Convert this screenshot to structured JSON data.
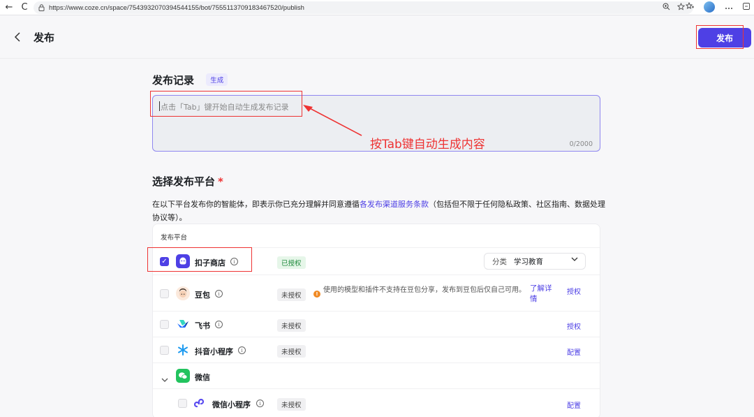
{
  "browser": {
    "url": "https://www.coze.cn/space/7543932070394544155/bot/7555113709183467520/publish",
    "nav": {
      "back": "←",
      "reload": "C"
    }
  },
  "header": {
    "back_icon": "‹",
    "title": "发布",
    "publish_label": "发布"
  },
  "record": {
    "title": "发布记录",
    "generate_tag": "生成",
    "placeholder": "点击「Tab」键开始自动生成发布记录",
    "count": "0/2000"
  },
  "annotation": {
    "text": "按Tab键自动生成内容"
  },
  "platform": {
    "title": "选择发布平台",
    "required": "*",
    "desc_before": "在以下平台发布你的智能体，即表示你已充分理解并同意遵循",
    "desc_link": "各发布渠道服务条款",
    "desc_after": "（包括但不限于任何隐私政策、社区指南、数据处理协议等）。",
    "column_header": "发布平台",
    "rows": {
      "kouzi": {
        "name": "扣子商店",
        "status": "已授权",
        "category_label": "分类",
        "category_value": "学习教育"
      },
      "doubao": {
        "name": "豆包",
        "status": "未授权",
        "warning": "使用的模型和插件不支持在豆包分享，发布到豆包后仅自己可用。",
        "more": "了解详情",
        "action": "授权"
      },
      "feishu": {
        "name": "飞书",
        "status": "未授权",
        "action": "授权"
      },
      "douyin": {
        "name": "抖音小程序",
        "status": "未授权",
        "action": "配置"
      },
      "weixin": {
        "name": "微信"
      },
      "wx_mini": {
        "name": "微信小程序",
        "status": "未授权",
        "action": "配置"
      }
    }
  },
  "colors": {
    "accent": "#4e40e5",
    "annotation": "#ee3333",
    "authorized": "#1f8a3c"
  }
}
